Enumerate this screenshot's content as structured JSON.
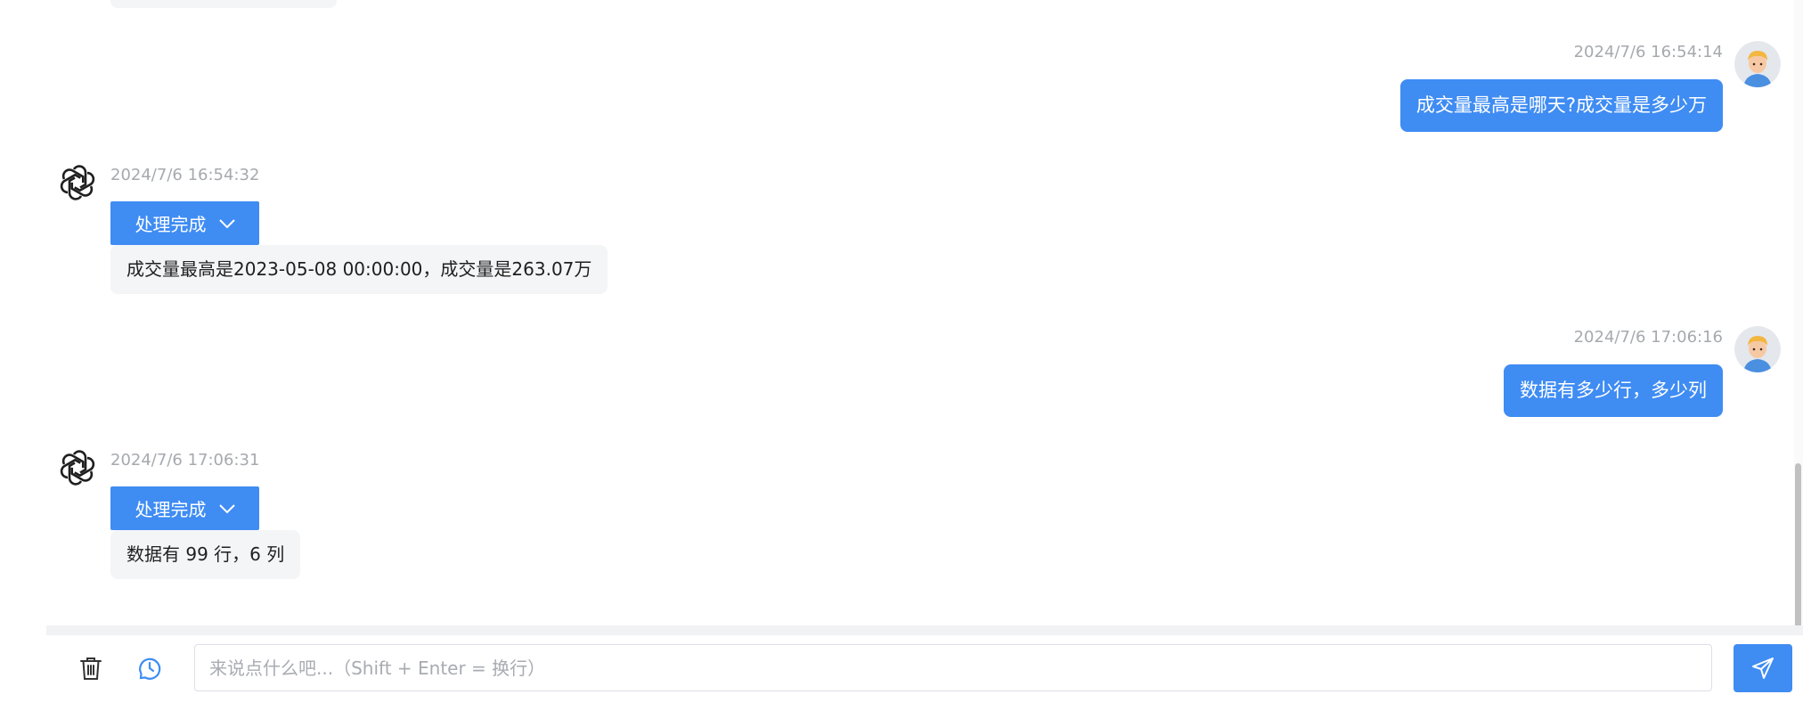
{
  "chat": {
    "messages": [
      {
        "role": "user",
        "time": "2024/7/6 16:54:14",
        "text": "成交量最高是哪天?成交量是多少万"
      },
      {
        "role": "assistant",
        "time": "2024/7/6 16:54:32",
        "status": "处理完成",
        "text": "成交量最高是2023-05-08 00:00:00，成交量是263.07万"
      },
      {
        "role": "user",
        "time": "2024/7/6 17:06:16",
        "text": "数据有多少行，多少列"
      },
      {
        "role": "assistant",
        "time": "2024/7/6 17:06:31",
        "status": "处理完成",
        "text": "数据有 99 行，6 列"
      }
    ]
  },
  "input": {
    "placeholder": "来说点什么吧...（Shift + Enter = 换行）",
    "value": ""
  },
  "icons": {
    "clear": "trash-icon",
    "history": "clock-icon",
    "send": "paper-plane-icon",
    "status_toggle": "chevron-down-icon",
    "bot_avatar": "openai-logo-icon",
    "user_avatar": "user-avatar"
  },
  "colors": {
    "primary": "#3f8cf3",
    "bot_bubble": "#f4f5f7",
    "timestamp": "#a6a9ae",
    "history_icon": "#3f8cf3"
  }
}
